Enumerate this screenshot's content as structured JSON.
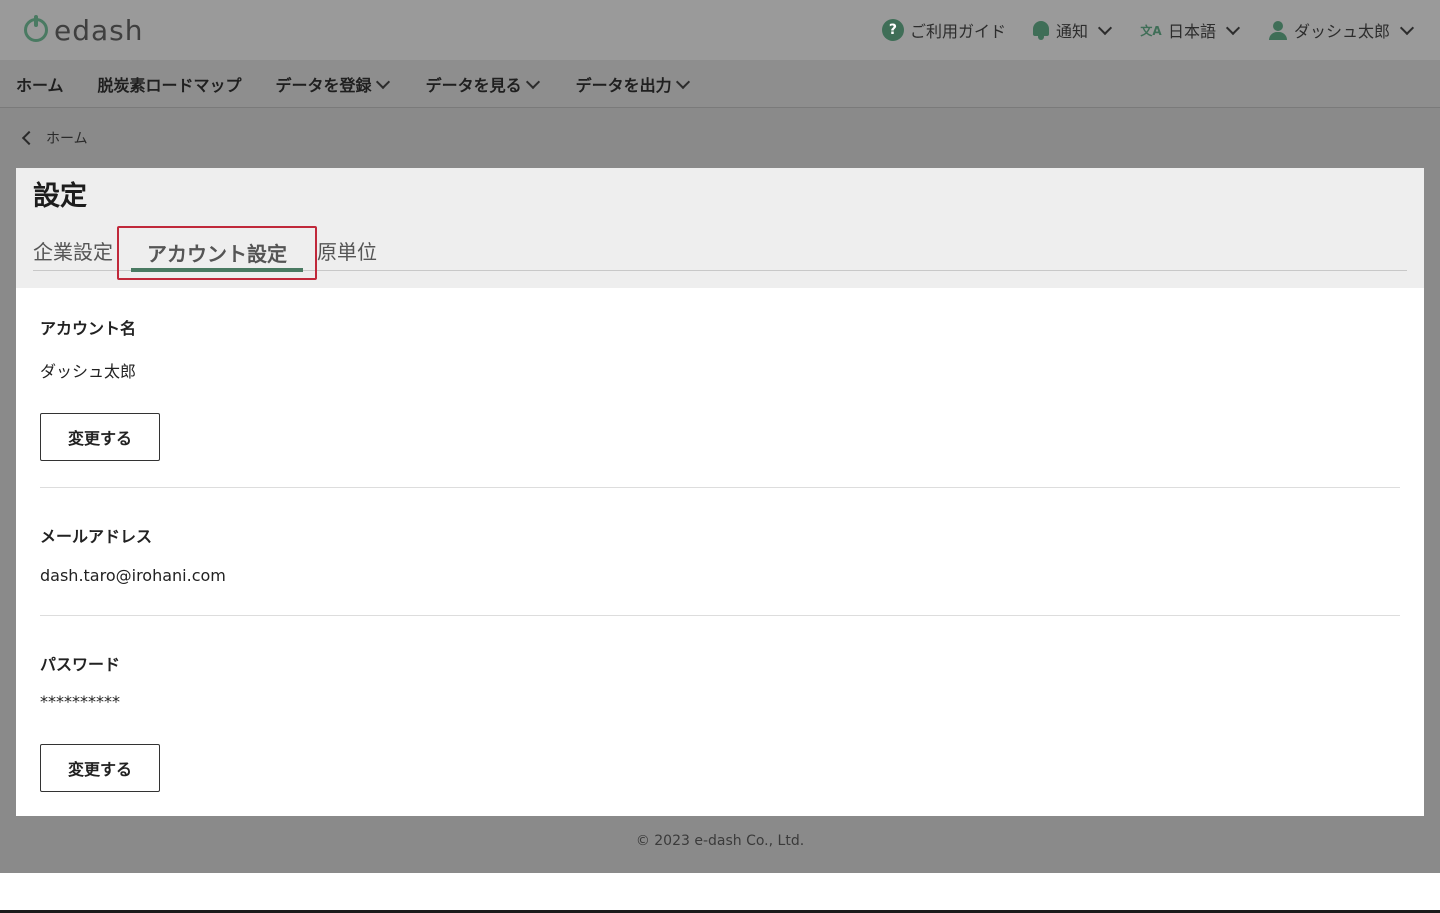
{
  "header": {
    "logo_text": "edash",
    "help_label": "ご利用ガイド",
    "help_glyph": "?",
    "notify_label": "通知",
    "lang_label": "日本語",
    "lang_glyph": "文A",
    "user_label": "ダッシュ太郎"
  },
  "nav": {
    "items": [
      {
        "label": "ホーム"
      },
      {
        "label": "脱炭素ロードマップ"
      },
      {
        "label": "データを登録"
      },
      {
        "label": "データを見る"
      },
      {
        "label": "データを出力"
      }
    ]
  },
  "breadcrumb": {
    "label": "ホーム"
  },
  "page": {
    "title": "設定",
    "tabs": [
      {
        "label": "企業設定"
      },
      {
        "label": "アカウント設定"
      },
      {
        "label": "原単位"
      }
    ],
    "active_tab": "アカウント設定"
  },
  "account": {
    "name_label": "アカウント名",
    "name_value": "ダッシュ太郎",
    "name_button": "変更する",
    "email_label": "メールアドレス",
    "email_value": "dash.taro@irohani.com",
    "password_label": "パスワード",
    "password_value": "**********",
    "password_button": "変更する"
  },
  "footer": {
    "copyright": "© 2023 e-dash Co., Ltd."
  },
  "colors": {
    "accent": "#4a7a62",
    "highlight": "#c0283a",
    "overlay": "#8a8a8a"
  }
}
